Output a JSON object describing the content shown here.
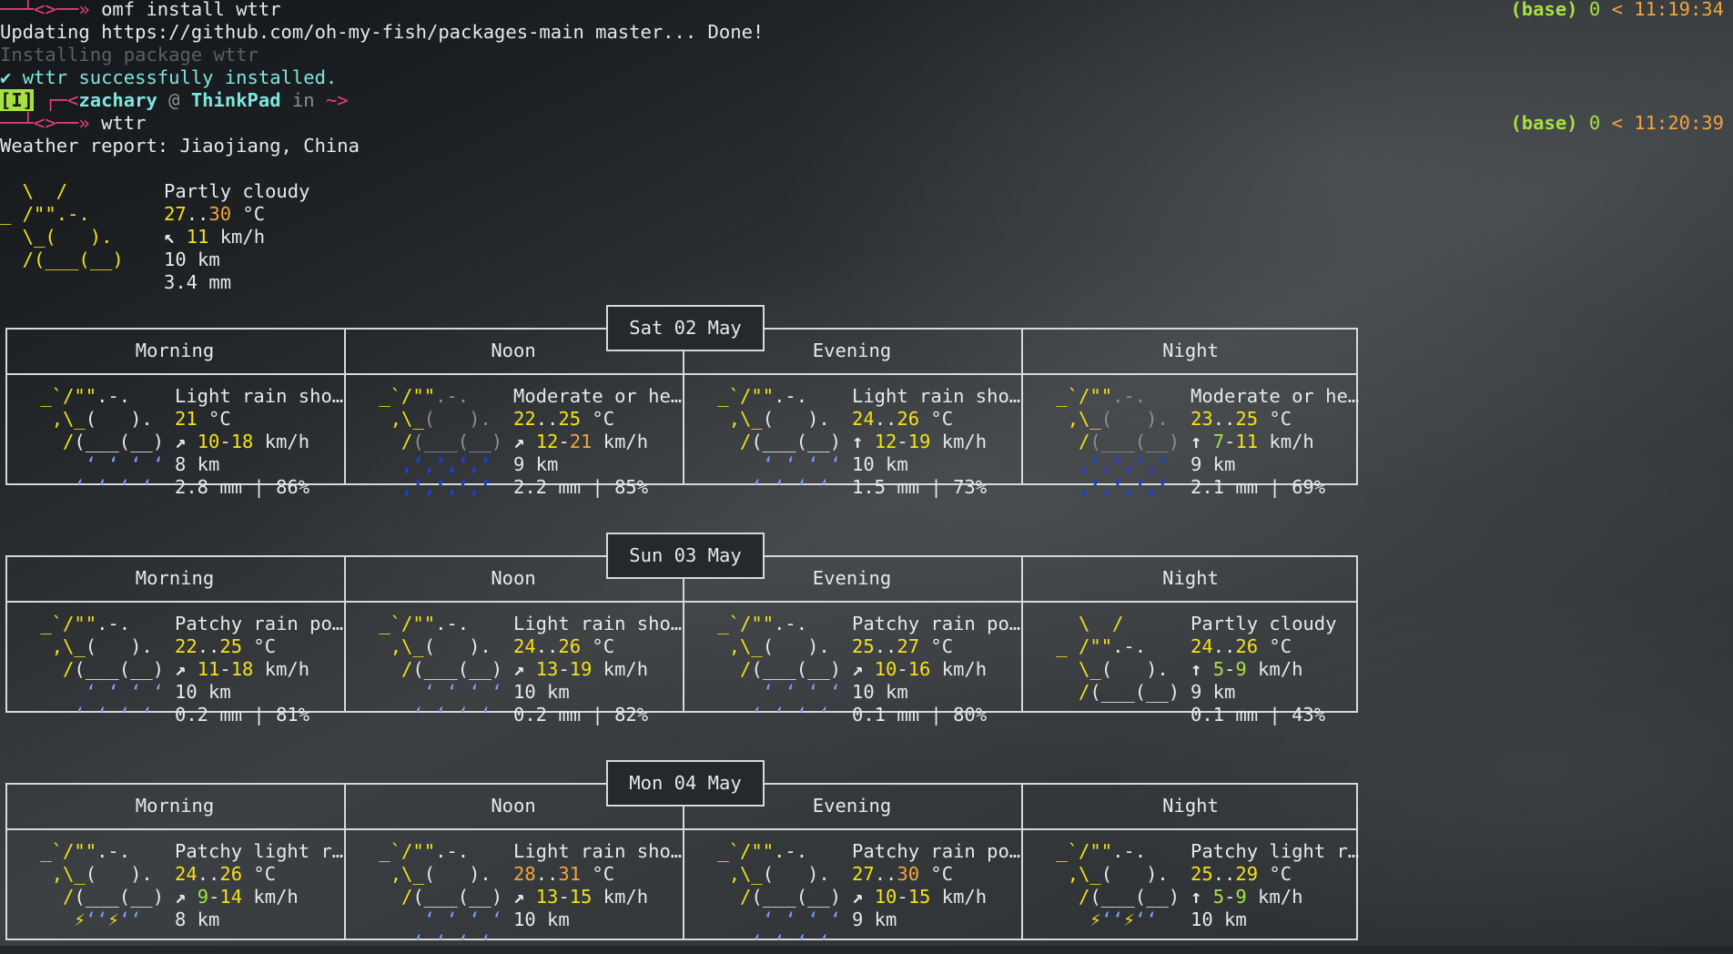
{
  "prompt_arrow": "──┴<>──»",
  "prompt_arrow_top": "┌─<",
  "lines": {
    "cmd1": "omf install wttr",
    "updating": "Updating https://github.com/oh-my-fish/packages-main master... Done!",
    "installing": "Installing package wttr",
    "success_check": "✔",
    "success": "wttr successfully installed.",
    "mode_badge": "[I]",
    "user": "zachary",
    "at": "@",
    "host": "ThinkPad",
    "in": "in",
    "cwd": "~>",
    "cmd2": "wttr",
    "report": "Weather report: Jiaojiang, China"
  },
  "rprompts": [
    {
      "env": "(base)",
      "status": "0",
      "sep": "<",
      "time": "11:19:34"
    },
    {
      "env": "(base)",
      "status": "0",
      "sep": "<",
      "time": "11:20:39"
    }
  ],
  "current": {
    "icon": [
      "  \\  /",
      "_ /\"\".-.",
      "  \\_(   ).",
      "  /(___(__)"
    ],
    "condition": "Partly cloudy",
    "temp_lo": "27",
    "temp_sep": "..",
    "temp_hi": "30",
    "temp_unit": "°C",
    "wind_arrow": "↖",
    "wind": "11",
    "wind_unit": "km/h",
    "visibility": "10 km",
    "precip": "3.4 mm"
  },
  "period_titles": [
    "Morning",
    "Noon",
    "Evening",
    "Night"
  ],
  "days": [
    {
      "date": "Sat 02 May",
      "periods": [
        {
          "icon": "rain",
          "condition": "Light rain sho…",
          "t1": "21",
          "t2": "",
          "arrow": "↗",
          "w1": "10",
          "w2": "18",
          "vis": "8 km",
          "precip": "2.8 mm | 86%"
        },
        {
          "icon": "heavyrain",
          "condition": "Moderate or he…",
          "t1": "22",
          "t2": "25",
          "arrow": "↗",
          "w1": "12",
          "w2": "21",
          "vis": "9 km",
          "precip": "2.2 mm | 85%"
        },
        {
          "icon": "rain",
          "condition": "Light rain sho…",
          "t1": "24",
          "t2": "26",
          "arrow": "↑",
          "w1": "12",
          "w2": "19",
          "vis": "10 km",
          "precip": "1.5 mm | 73%"
        },
        {
          "icon": "heavyrain",
          "condition": "Moderate or he…",
          "t1": "23",
          "t2": "25",
          "arrow": "↑",
          "w1": "7",
          "w2": "11",
          "vis": "9 km",
          "precip": "2.1 mm | 69%"
        }
      ]
    },
    {
      "date": "Sun 03 May",
      "periods": [
        {
          "icon": "rain",
          "condition": "Patchy rain po…",
          "t1": "22",
          "t2": "25",
          "arrow": "↗",
          "w1": "11",
          "w2": "18",
          "vis": "10 km",
          "precip": "0.2 mm | 81%"
        },
        {
          "icon": "rain",
          "condition": "Light rain sho…",
          "t1": "24",
          "t2": "26",
          "arrow": "↗",
          "w1": "13",
          "w2": "19",
          "vis": "10 km",
          "precip": "0.2 mm | 82%"
        },
        {
          "icon": "rain",
          "condition": "Patchy rain po…",
          "t1": "25",
          "t2": "27",
          "arrow": "↗",
          "w1": "10",
          "w2": "16",
          "vis": "10 km",
          "precip": "0.1 mm | 80%"
        },
        {
          "icon": "partly",
          "condition": "Partly cloudy",
          "t1": "24",
          "t2": "26",
          "arrow": "↑",
          "w1": "5",
          "w2": "9",
          "vis": "9 km",
          "precip": "0.1 mm | 43%"
        }
      ]
    },
    {
      "date": "Mon 04 May",
      "periods": [
        {
          "icon": "thunder",
          "condition": "Patchy light r…",
          "t1": "24",
          "t2": "26",
          "arrow": "↗",
          "w1": "9",
          "w2": "14",
          "vis": "8 km",
          "precip": ""
        },
        {
          "icon": "rain",
          "condition": "Light rain sho…",
          "t1": "28",
          "t2": "31",
          "arrow": "↗",
          "w1": "13",
          "w2": "15",
          "vis": "10 km",
          "precip": ""
        },
        {
          "icon": "rain",
          "condition": "Patchy rain po…",
          "t1": "27",
          "t2": "30",
          "arrow": "↗",
          "w1": "10",
          "w2": "15",
          "vis": "9 km",
          "precip": ""
        },
        {
          "icon": "thunder",
          "condition": "Patchy light r…",
          "t1": "25",
          "t2": "29",
          "arrow": "↑",
          "w1": "5",
          "w2": "9",
          "vis": "10 km",
          "precip": ""
        }
      ]
    }
  ],
  "colors": {
    "temp_warm": "#f5e018",
    "temp_hot": "#f3a43a",
    "wind_low": "#a8e040",
    "wind_mid": "#f5e018",
    "wind_high": "#f3a43a",
    "rain": "#7aa0ff",
    "heavy_rain": "#1d3de0",
    "cloud": "#e8e8e8",
    "sun": "#f5e018"
  }
}
